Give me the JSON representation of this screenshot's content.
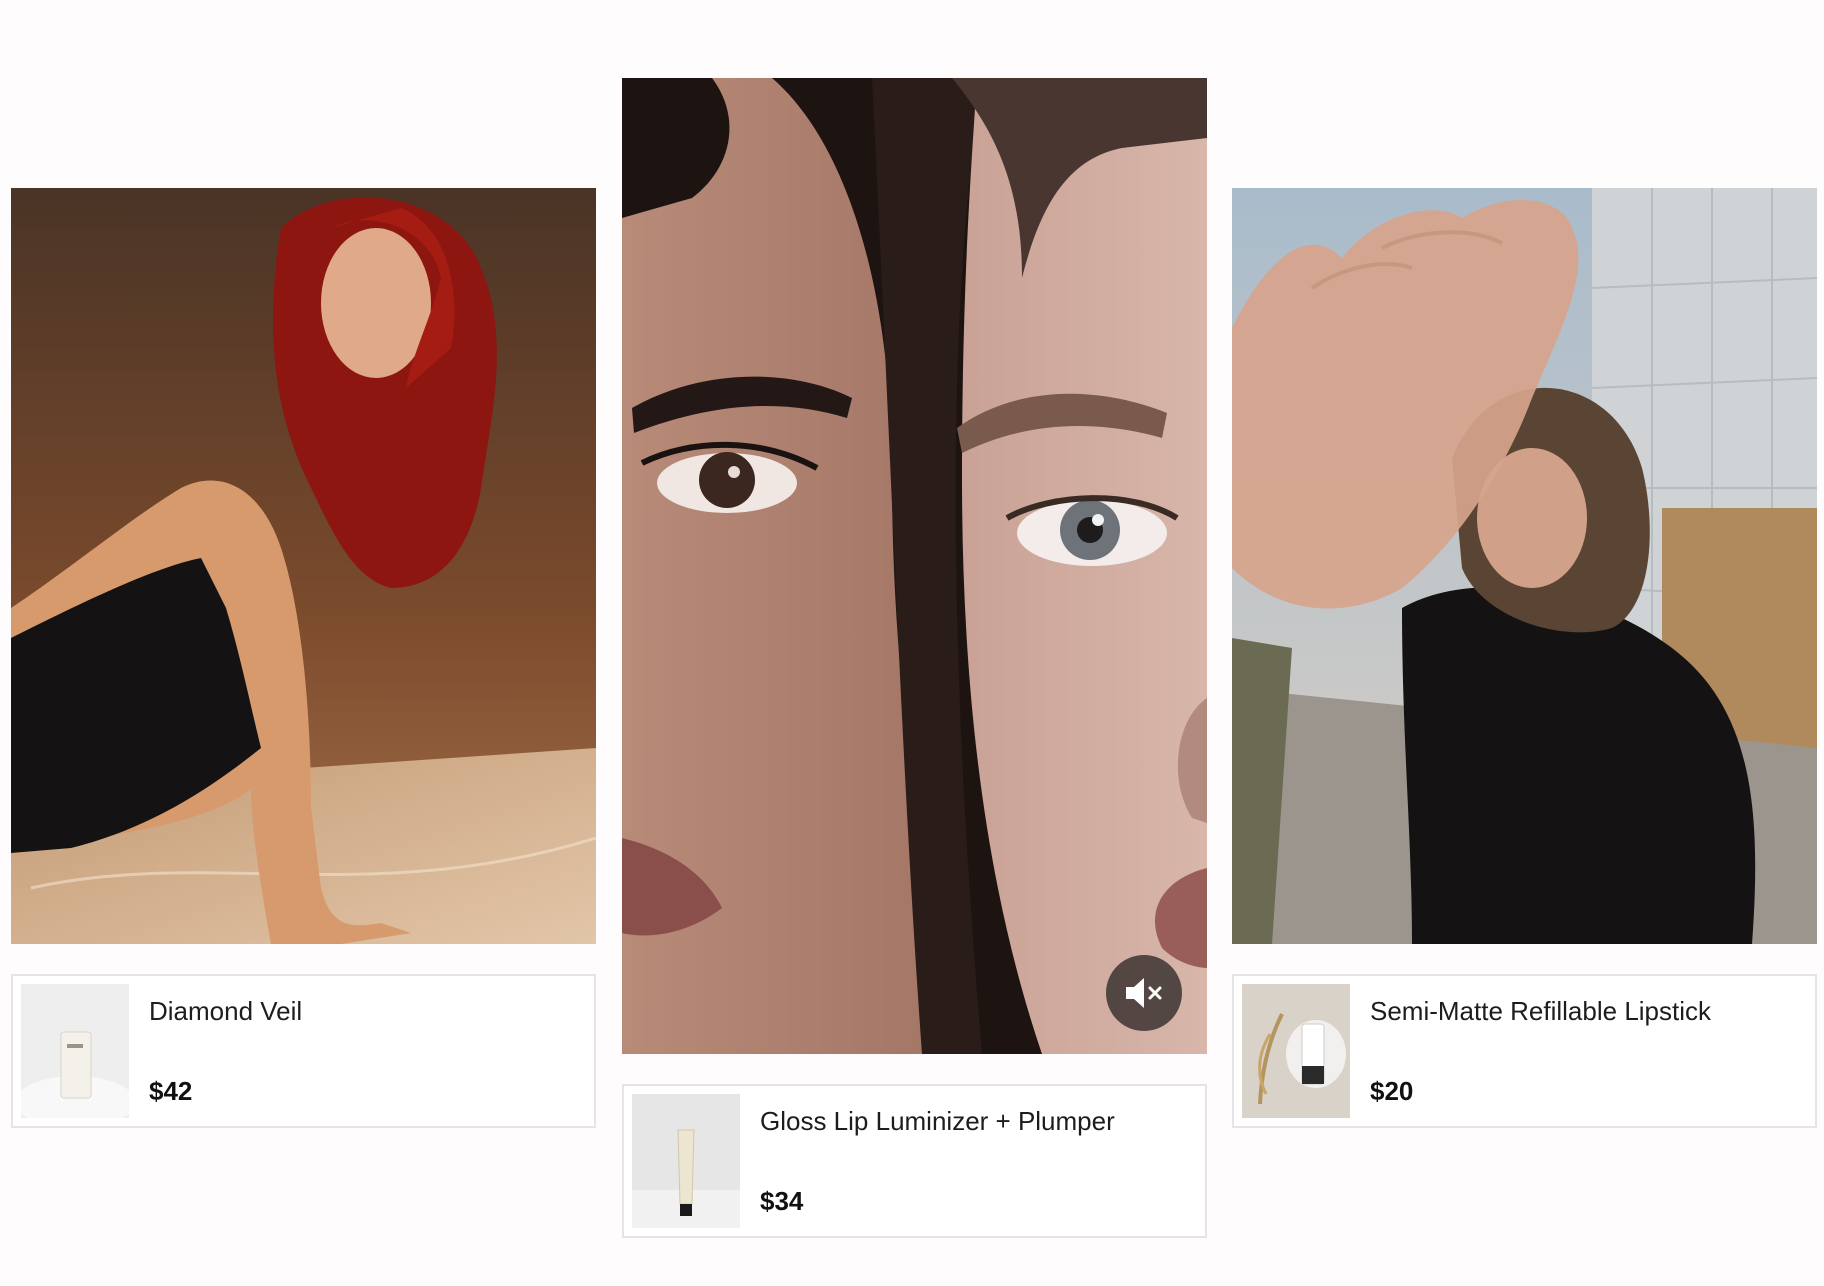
{
  "cards": [
    {
      "media_alt": "Model with red hair and glitter body makeup",
      "product": {
        "name": "Diamond Veil",
        "price": "$42",
        "thumb": "white tube on white fabric"
      }
    },
    {
      "media_alt": "Two faces close-up video",
      "mute_icon": "speaker-muted-icon",
      "product": {
        "name": "Gloss Lip Luminizer + Plumper",
        "price": "$34",
        "thumb": "cream tube standing"
      }
    },
    {
      "media_alt": "Woman blocking camera with hand",
      "product": {
        "name": "Semi-Matte Refillable Lipstick",
        "price": "$20",
        "thumb": "white product with dried grass"
      }
    }
  ],
  "colors": {
    "background": "#fefcfd",
    "border": "#e6e4e6",
    "mute_button": "#3c3432"
  }
}
